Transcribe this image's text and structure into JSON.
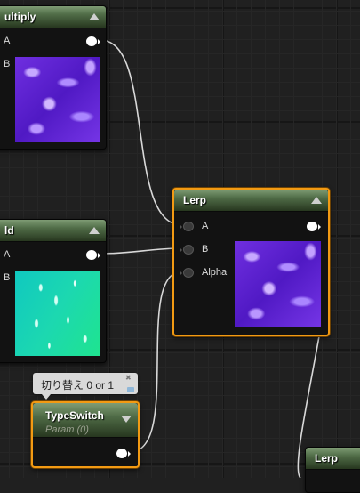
{
  "nodes": {
    "multiply": {
      "title": "ultiply",
      "pins": {
        "a": "A",
        "b": "B"
      }
    },
    "add": {
      "title": "ld",
      "pins": {
        "a": "A",
        "b": "B"
      }
    },
    "lerp": {
      "title": "Lerp",
      "pins": {
        "a": "A",
        "b": "B",
        "alpha": "Alpha"
      }
    },
    "type_switch": {
      "title": "TypeSwitch",
      "subtitle": "Param (0)"
    },
    "lerp2": {
      "title": "Lerp"
    }
  },
  "comment": {
    "text": "切り替え 0 or 1"
  },
  "colors": {
    "selection": "#f29a13",
    "header": "#4f6b46",
    "wire": "#d8d8d8",
    "background": "#202020"
  },
  "icons": [
    "collapse-arrow-icon",
    "expand-arrow-icon",
    "pin-icon",
    "comment-bubble-icon"
  ]
}
